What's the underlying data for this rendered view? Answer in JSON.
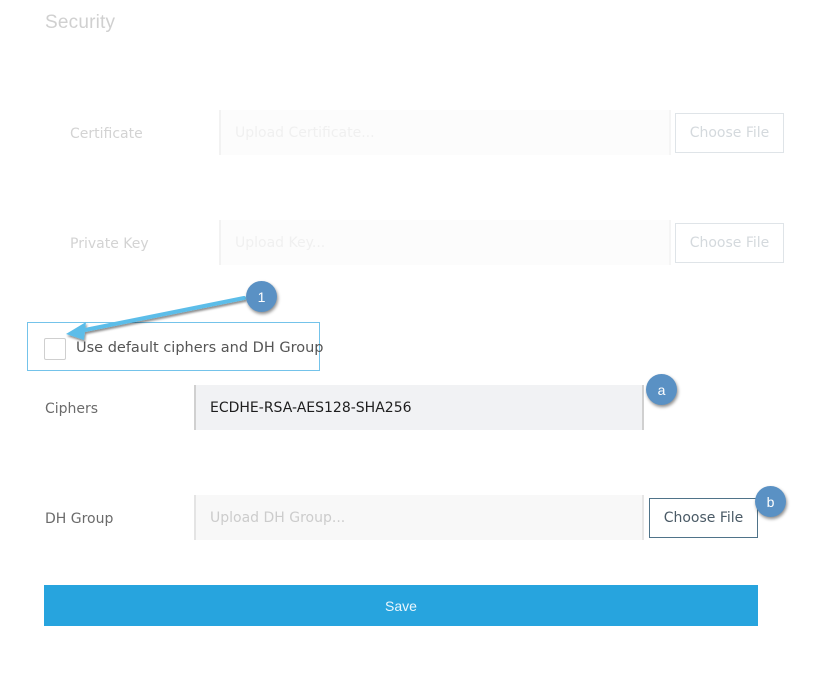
{
  "page": {
    "title": "Security"
  },
  "certificate": {
    "label": "Certificate",
    "placeholder": "Upload Certificate...",
    "button": "Choose File"
  },
  "private_key": {
    "label": "Private Key",
    "placeholder": "Upload Key...",
    "button": "Choose File"
  },
  "default_ciphers": {
    "label": "Use default ciphers and DH Group",
    "checked": false
  },
  "ciphers": {
    "label": "Ciphers",
    "value": "ECDHE-RSA-AES128-SHA256"
  },
  "dh_group": {
    "label": "DH Group",
    "placeholder": "Upload DH Group...",
    "button": "Choose File"
  },
  "save": {
    "label": "Save"
  },
  "annotations": {
    "callout_1": "1",
    "callout_a": "a",
    "callout_b": "b",
    "accent_color": "#5a91c4",
    "highlight_color": "#74c3ea",
    "save_color": "#27a4de"
  }
}
